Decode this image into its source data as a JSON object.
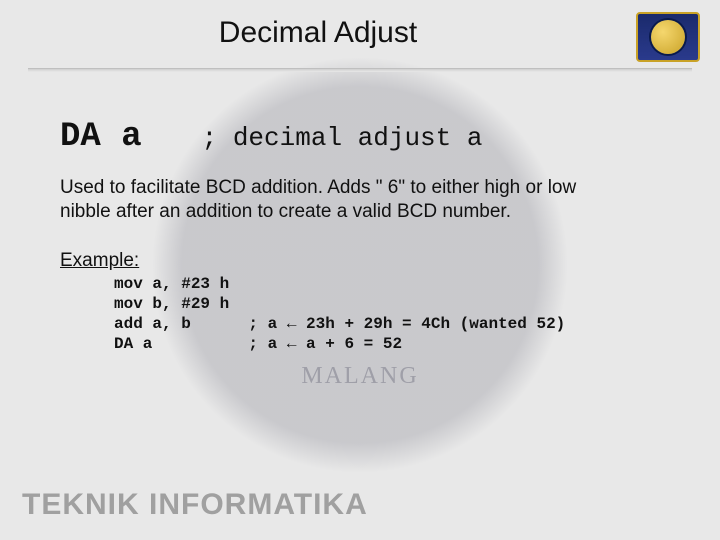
{
  "title": "Decimal Adjust",
  "logo_name": "ub-logo",
  "heading": {
    "mnemonic": "DA a",
    "comment": "; decimal adjust a"
  },
  "description": "Used to facilitate BCD addition.\nAdds \" 6\" to either high or low nibble after an addition to create a valid BCD number.",
  "example_label": "Example:",
  "code": {
    "l1_op": "mov a, #23 h",
    "l2_op": "mov b, #29 h",
    "l3_op": "add a, b",
    "l3_comment": "; a ← 23h + 29h = 4Ch (wanted 52)",
    "l4_op": "DA a",
    "l4_comment": "; a ← a + 6 = 52"
  },
  "footer": "TEKNIK INFORMATIKA"
}
